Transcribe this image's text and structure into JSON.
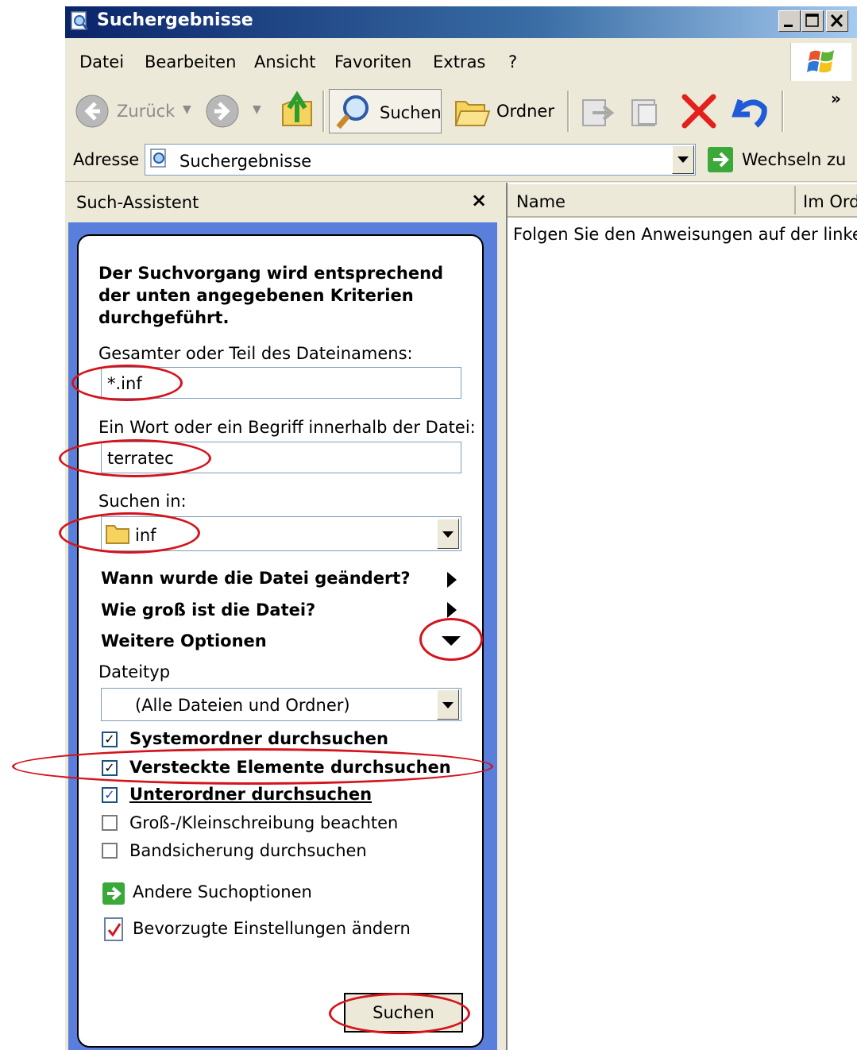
{
  "window": {
    "title": "Suchergebnisse"
  },
  "menu": [
    "Datei",
    "Bearbeiten",
    "Ansicht",
    "Favoriten",
    "Extras",
    "?"
  ],
  "toolbar": {
    "back_label": "Zurück",
    "search_label": "Suchen",
    "folders_label": "Ordner",
    "overflow": "»"
  },
  "address": {
    "label": "Adresse",
    "value": "Suchergebnisse",
    "go_label": "Wechseln zu"
  },
  "search_panel": {
    "header": "Such-Assistent",
    "close": "×",
    "intro_line1": "Der Suchvorgang wird entsprechend",
    "intro_line2": "der unten angegebenen Kriterien",
    "intro_line3": "durchgeführt.",
    "filename_label": "Gesamter oder Teil des Dateinamens:",
    "filename_value": "*.inf",
    "word_label": "Ein Wort oder ein Begriff innerhalb der Datei:",
    "word_value": "terratec",
    "search_in_label": "Suchen in:",
    "search_in_value": "inf",
    "when_modified": "Wann wurde die Datei geändert?",
    "size": "Wie groß ist die Datei?",
    "more_options": "Weitere Optionen",
    "filetype_label": "Dateityp",
    "filetype_value": "(Alle Dateien und Ordner)",
    "options": [
      {
        "label": "Systemordner durchsuchen",
        "checked": true
      },
      {
        "label": "Versteckte Elemente durchsuchen",
        "checked": true
      },
      {
        "label": "Unterordner durchsuchen",
        "checked": true
      },
      {
        "label": "Groß-/Kleinschreibung beachten",
        "checked": false
      },
      {
        "label": "Bandsicherung durchsuchen",
        "checked": false
      }
    ],
    "other_options": "Andere Suchoptionen",
    "preferences": "Bevorzugte Einstellungen ändern",
    "search_button": "Suchen"
  },
  "results": {
    "columns": [
      "Name",
      "Im Ord"
    ],
    "message": "Folgen Sie den Anweisungen auf der linken S"
  },
  "colors": {
    "annotation": "#d4141c",
    "taskpane": "#5a7edc",
    "titlebar": "#0a246a"
  }
}
